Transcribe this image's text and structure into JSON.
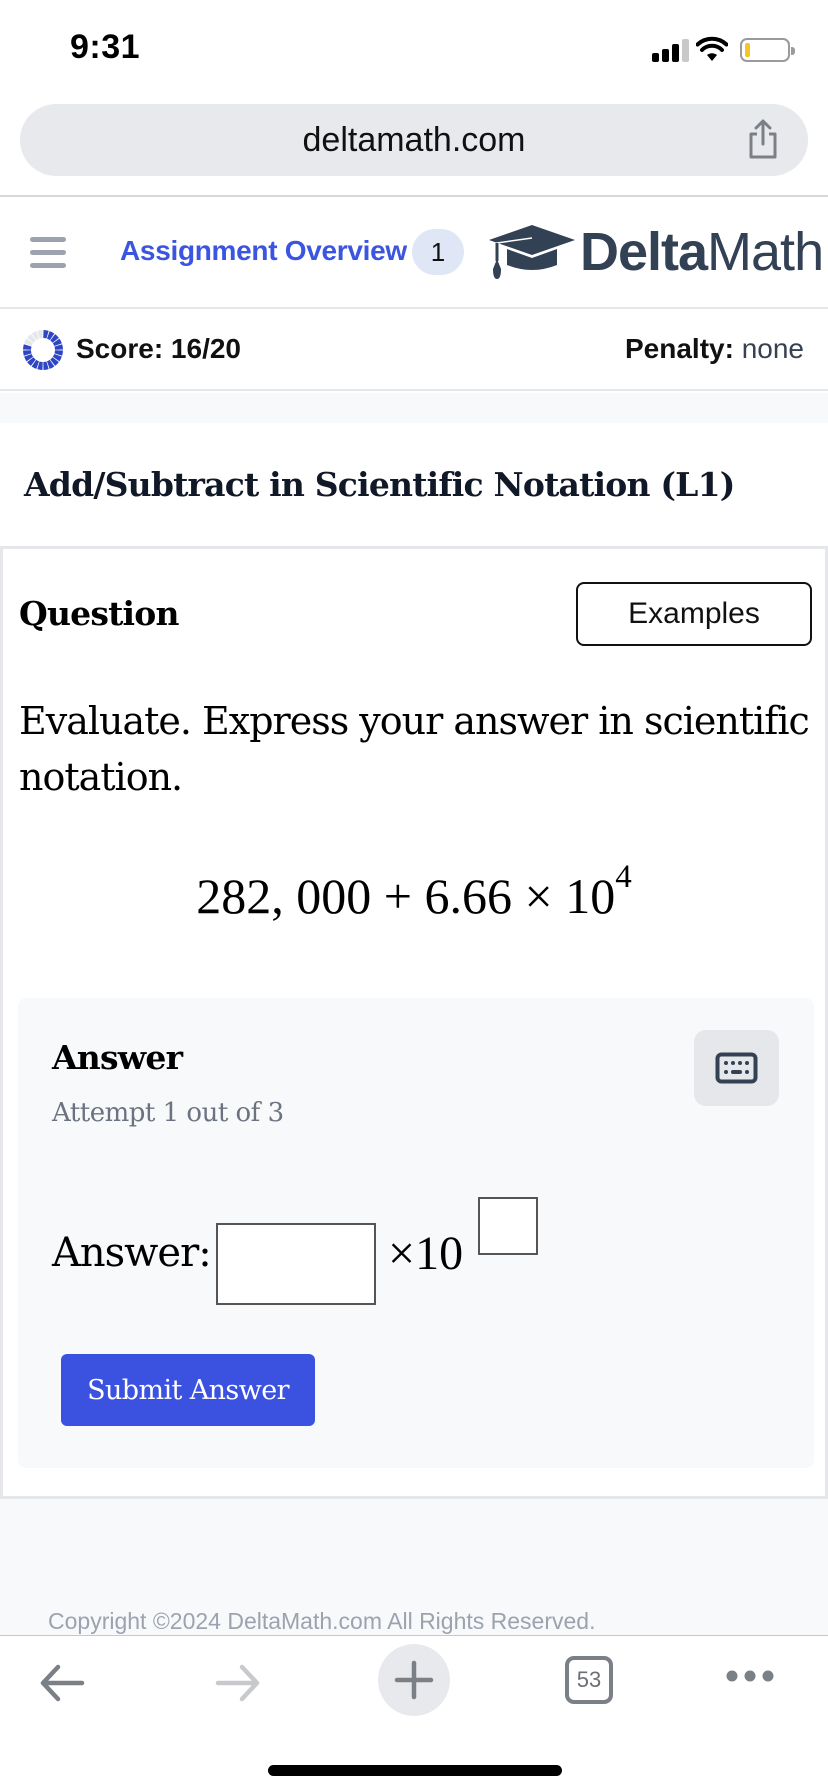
{
  "status_bar": {
    "time": "9:31",
    "signal_icon": "cellular-signal-icon",
    "wifi_icon": "wifi-icon",
    "battery_icon": "battery-low-icon",
    "battery_level_percent": 10,
    "battery_color": "#f5c525"
  },
  "browser": {
    "url": "deltamath.com",
    "share_icon": "share-icon",
    "toolbar": {
      "back_icon": "arrow-left-icon",
      "forward_icon": "arrow-right-icon",
      "new_tab_icon": "plus-icon",
      "tab_count": "53",
      "more_icon": "ellipsis-icon"
    }
  },
  "header": {
    "menu_icon": "hamburger-menu-icon",
    "nav_link": "Assignment Overview",
    "nav_badge": "1",
    "logo_icon": "graduation-cap-icon",
    "logo_bold": "Delta",
    "logo_regular": "Math",
    "accent_color": "#3b55e0"
  },
  "score": {
    "label": "Score: 16/20",
    "earned": 16,
    "total": 20,
    "ring_icon": "score-progress-ring-icon",
    "ring_color": "#2e46c4",
    "penalty_label": "Penalty:",
    "penalty_value": "none"
  },
  "problem": {
    "title": "Add/Subtract in Scientific Notation (L1)",
    "question_label": "Question",
    "examples_button": "Examples",
    "prompt": "Evaluate. Express your answer in scientific notation.",
    "expression": {
      "left": "282, 000 + 6.66 × 10",
      "exponent": "4"
    }
  },
  "answer": {
    "heading": "Answer",
    "attempt": "Attempt 1 out of 3",
    "keyboard_icon": "keyboard-icon",
    "field_label": "Answer:",
    "mantissa_value": "",
    "times_ten": "×10",
    "exponent_value": "",
    "submit_button": "Submit Answer",
    "submit_color": "#3b52e0"
  },
  "footer": {
    "copyright": "Copyright ©2024 DeltaMath.com All Rights Reserved."
  }
}
